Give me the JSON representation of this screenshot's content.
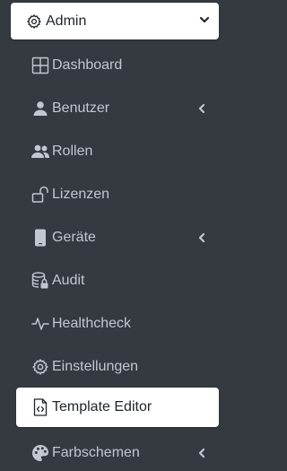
{
  "header": {
    "label": "Admin",
    "icon": "gear-icon",
    "expand_icon": "chevron-down-icon"
  },
  "items": [
    {
      "label": "Dashboard",
      "icon": "grid-icon",
      "submenu": false
    },
    {
      "label": "Benutzer",
      "icon": "user-icon",
      "submenu": true
    },
    {
      "label": "Rollen",
      "icon": "users-icon",
      "submenu": false
    },
    {
      "label": "Lizenzen",
      "icon": "unlock-icon",
      "submenu": false
    },
    {
      "label": "Geräte",
      "icon": "mobile-icon",
      "submenu": true
    },
    {
      "label": "Audit",
      "icon": "database-lock-icon",
      "submenu": false
    },
    {
      "label": "Healthcheck",
      "icon": "pulse-icon",
      "submenu": false
    },
    {
      "label": "Einstellungen",
      "icon": "gear-icon",
      "submenu": false
    },
    {
      "label": "Template Editor",
      "icon": "file-code-icon",
      "submenu": false,
      "active": true
    },
    {
      "label": "Farbschemen",
      "icon": "palette-icon",
      "submenu": true
    }
  ],
  "colors": {
    "sidebar_bg": "#343a40",
    "item_text": "#c2c7d0",
    "active_bg": "#ffffff",
    "active_text": "#212529"
  }
}
